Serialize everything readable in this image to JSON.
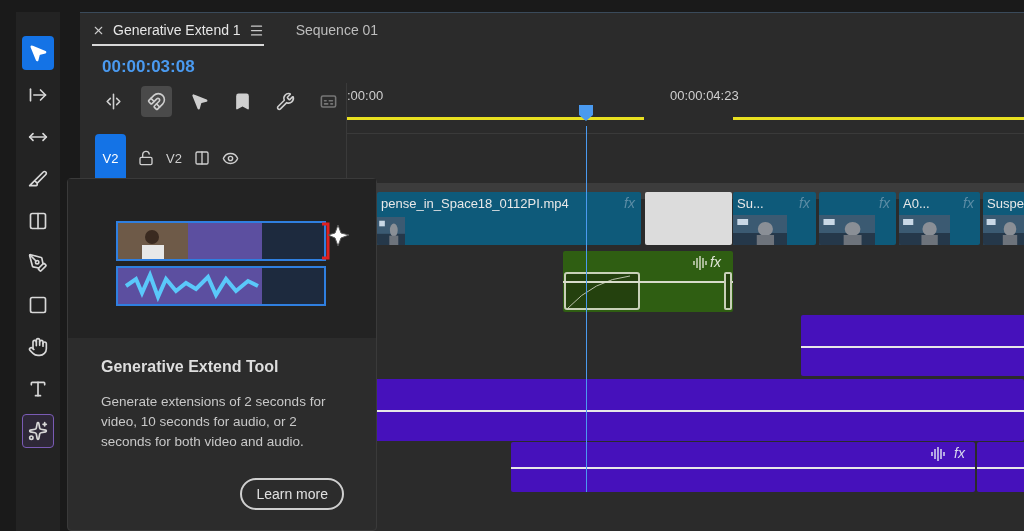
{
  "tools": [
    {
      "kind": "select",
      "selected": true
    },
    {
      "kind": "track-select",
      "selected": false
    },
    {
      "kind": "ripple",
      "selected": false
    },
    {
      "kind": "razor",
      "selected": false
    },
    {
      "kind": "slip",
      "selected": false
    },
    {
      "kind": "pen",
      "selected": false
    },
    {
      "kind": "rectangle",
      "selected": false
    },
    {
      "kind": "hand",
      "selected": false
    },
    {
      "kind": "type",
      "selected": false
    },
    {
      "kind": "generative-extend",
      "selected": false,
      "hovered": true
    }
  ],
  "tabs": [
    {
      "label": "Generative Extend 1",
      "selected": true
    },
    {
      "label": "Sequence 01",
      "selected": false
    }
  ],
  "timecode": "00:00:03:08",
  "timeline_tools": [
    {
      "kind": "insert",
      "selected": false
    },
    {
      "kind": "snap",
      "selected": true
    },
    {
      "kind": "linked",
      "selected": false
    },
    {
      "kind": "marker",
      "selected": false
    },
    {
      "kind": "settings",
      "selected": false
    },
    {
      "kind": "captions",
      "selected": false
    }
  ],
  "ruler": {
    "labels": [
      ":00:00",
      "00:00:04:23"
    ]
  },
  "track_header": {
    "target": "V2",
    "name": "V2"
  },
  "clips": [
    {
      "kind": "video",
      "label": "pense_in_Space18_0112PI.mp4",
      "fx": "fx"
    },
    {
      "kind": "gap"
    },
    {
      "kind": "video",
      "label": "Su...",
      "fx": "fx"
    },
    {
      "kind": "video",
      "fx": "fx"
    },
    {
      "kind": "video",
      "label": "A0...",
      "fx": "fx"
    },
    {
      "kind": "video",
      "label": "Suspe"
    },
    {
      "kind": "audio-green",
      "fx": "fx"
    },
    {
      "kind": "audio"
    },
    {
      "kind": "audio"
    },
    {
      "kind": "audio",
      "fx": "fx"
    },
    {
      "kind": "audio"
    }
  ],
  "tooltip": {
    "title": "Generative Extend Tool",
    "description": "Generate extensions of 2 seconds for video, 10 seconds for audio, or 2 seconds for both video and audio.",
    "button": "Learn more"
  }
}
